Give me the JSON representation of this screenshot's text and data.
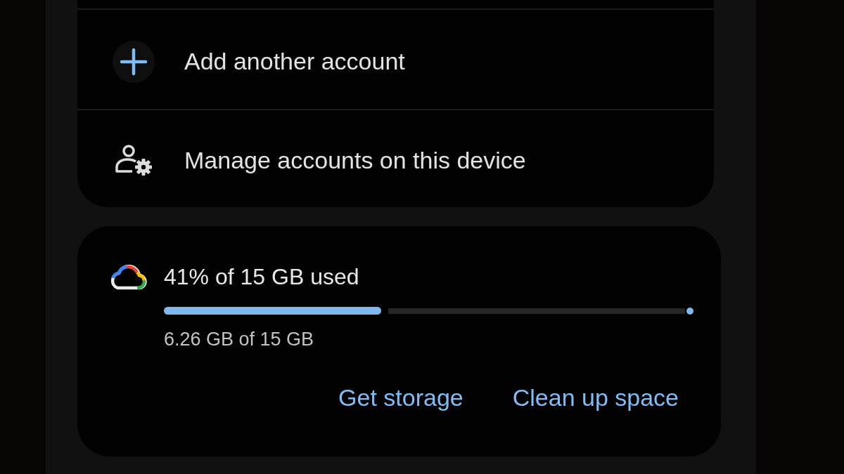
{
  "account_menu": {
    "items": [
      {
        "kind": "add",
        "label": "Add another account"
      },
      {
        "kind": "manage",
        "label": "Manage accounts on this device"
      }
    ]
  },
  "storage": {
    "title": "41% of 15 GB used",
    "level": 0.41,
    "detail": "6.26 GB of 15 GB",
    "actions": [
      "Get storage",
      "Clean up space"
    ]
  }
}
